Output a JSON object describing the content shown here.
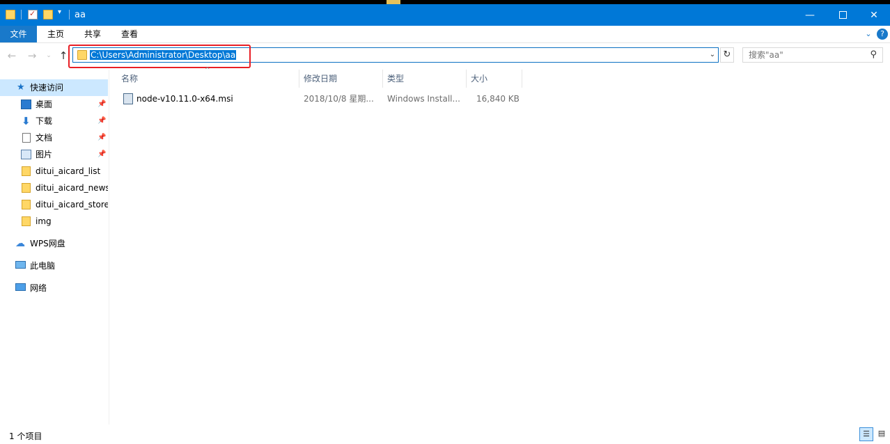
{
  "window": {
    "title": "aa"
  },
  "ribbon": {
    "tabs": [
      "文件",
      "主页",
      "共享",
      "查看"
    ]
  },
  "address": {
    "path": "C:\\Users\\Administrator\\Desktop\\aa"
  },
  "search": {
    "placeholder": "搜索\"aa\""
  },
  "sidebar": {
    "quick_access": "快速访问",
    "items": [
      {
        "label": "桌面",
        "icon": "desktop-icon",
        "pinned": true
      },
      {
        "label": "下载",
        "icon": "download-icon",
        "pinned": true
      },
      {
        "label": "文档",
        "icon": "document-icon",
        "pinned": true
      },
      {
        "label": "图片",
        "icon": "picture-icon",
        "pinned": true
      },
      {
        "label": "ditui_aicard_list",
        "icon": "folder-icon",
        "pinned": false
      },
      {
        "label": "ditui_aicard_news",
        "icon": "folder-icon",
        "pinned": false
      },
      {
        "label": "ditui_aicard_store",
        "icon": "folder-icon",
        "pinned": false
      },
      {
        "label": "img",
        "icon": "folder-icon",
        "pinned": false
      }
    ],
    "wps": "WPS网盘",
    "this_pc": "此电脑",
    "network": "网络"
  },
  "columns": [
    "名称",
    "修改日期",
    "类型",
    "大小"
  ],
  "files": [
    {
      "name": "node-v10.11.0-x64.msi",
      "date": "2018/10/8 星期...",
      "type": "Windows Install...",
      "size": "16,840 KB",
      "icon": "msi-installer-icon"
    }
  ],
  "status": {
    "count": "1 个项目"
  },
  "colors": {
    "titlebar": "#0078d7",
    "selection": "#cce8ff",
    "highlight_box": "#e81e25"
  }
}
